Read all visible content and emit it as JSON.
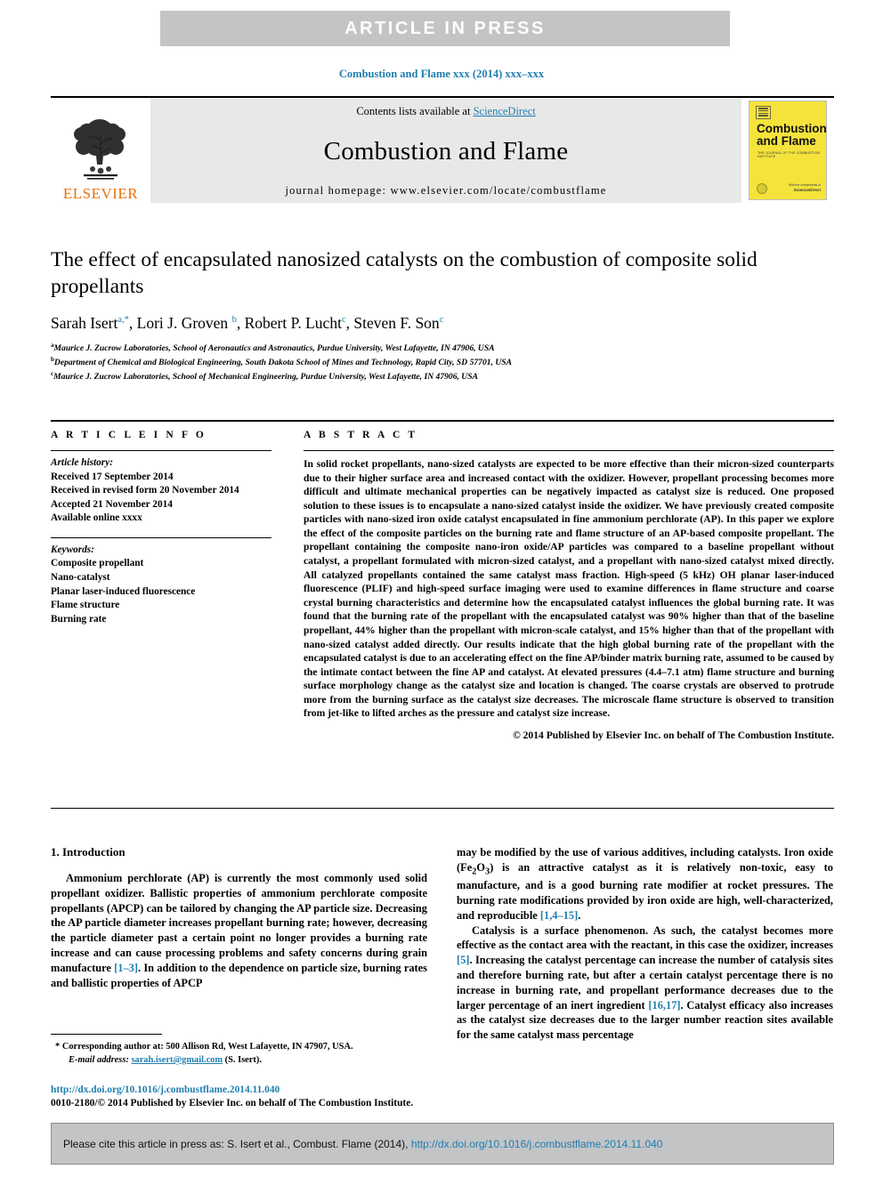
{
  "banner": {
    "text": "ARTICLE  IN  PRESS"
  },
  "journal_ref": "Combustion and Flame xxx (2014) xxx–xxx",
  "masthead": {
    "publisher": "ELSEVIER",
    "contents_prefix": "Contents lists available at ",
    "contents_link": "ScienceDirect",
    "journal_title": "Combustion and Flame",
    "homepage": "journal homepage: www.elsevier.com/locate/combustflame",
    "cover": {
      "line1": "Combustion",
      "line2": "and Flame",
      "subtitle": "THE JOURNAL OF THE COMBUSTION INSTITUTE",
      "footer_small": "With the compliments of",
      "footer_bold": "ScienceDirect"
    }
  },
  "article": {
    "title": "The effect of encapsulated nanosized catalysts on the combustion of composite solid propellants",
    "authors": [
      {
        "name": "Sarah Isert",
        "sup": "a,*"
      },
      {
        "name": "Lori J. Groven",
        "sup": "b"
      },
      {
        "name": "Robert P. Lucht",
        "sup": "c"
      },
      {
        "name": "Steven F. Son",
        "sup": "c"
      }
    ],
    "affiliations": [
      {
        "mark": "a",
        "text": "Maurice J. Zucrow Laboratories, School of Aeronautics and Astronautics, Purdue University, West Lafayette, IN 47906, USA"
      },
      {
        "mark": "b",
        "text": "Department of Chemical and Biological Engineering, South Dakota School of Mines and Technology, Rapid City, SD 57701, USA"
      },
      {
        "mark": "c",
        "text": "Maurice J. Zucrow Laboratories, School of Mechanical Engineering, Purdue University, West Lafayette, IN 47906, USA"
      }
    ]
  },
  "article_info": {
    "heading": "A R T I C L E    I N F O",
    "history_label": "Article history:",
    "history": [
      "Received 17 September 2014",
      "Received in revised form 20 November 2014",
      "Accepted 21 November 2014",
      "Available online xxxx"
    ],
    "keywords_label": "Keywords:",
    "keywords": [
      "Composite propellant",
      "Nano-catalyst",
      "Planar laser-induced fluorescence",
      "Flame structure",
      "Burning rate"
    ]
  },
  "abstract": {
    "heading": "A B S T R A C T",
    "body": "In solid rocket propellants, nano-sized catalysts are expected to be more effective than their micron-sized counterparts due to their higher surface area and increased contact with the oxidizer. However, propellant processing becomes more difficult and ultimate mechanical properties can be negatively impacted as catalyst size is reduced. One proposed solution to these issues is to encapsulate a nano-sized catalyst inside the oxidizer. We have previously created composite particles with nano-sized iron oxide catalyst encapsulated in fine ammonium perchlorate (AP). In this paper we explore the effect of the composite particles on the burning rate and flame structure of an AP-based composite propellant. The propellant containing the composite nano-iron oxide/AP particles was compared to a baseline propellant without catalyst, a propellant formulated with micron-sized catalyst, and a propellant with nano-sized catalyst mixed directly. All catalyzed propellants contained the same catalyst mass fraction. High-speed (5 kHz) OH planar laser-induced fluorescence (PLIF) and high-speed surface imaging were used to examine differences in flame structure and coarse crystal burning characteristics and determine how the encapsulated catalyst influences the global burning rate. It was found that the burning rate of the propellant with the encapsulated catalyst was 90% higher than that of the baseline propellant, 44% higher than the propellant with micron-scale catalyst, and 15% higher than that of the propellant with nano-sized catalyst added directly. Our results indicate that the high global burning rate of the propellant with the encapsulated catalyst is due to an accelerating effect on the fine AP/binder matrix burning rate, assumed to be caused by the intimate contact between the fine AP and catalyst. At elevated pressures (4.4–7.1 atm) flame structure and burning surface morphology change as the catalyst size and location is changed. The coarse crystals are observed to protrude more from the burning surface as the catalyst size decreases. The microscale flame structure is observed to transition from jet-like to lifted arches as the pressure and catalyst size increase.",
    "copyright": "© 2014 Published by Elsevier Inc. on behalf of The Combustion Institute."
  },
  "introduction": {
    "section_title": "1. Introduction",
    "left_para_1_a": "Ammonium perchlorate (AP) is currently the most commonly used solid propellant oxidizer. Ballistic properties of ammonium perchlorate composite propellants (APCP) can be tailored by changing the AP particle size. Decreasing the AP particle diameter increases propellant burning rate; however, decreasing the particle diameter past a certain point no longer provides a burning rate increase and can cause processing problems and safety concerns during grain manufacture ",
    "left_ref_1": "[1–3]",
    "left_para_1_b": ". In addition to the dependence on particle size, burning rates and ballistic properties of APCP",
    "right_para_1_a": "may be modified by the use of various additives, including catalysts. Iron oxide (Fe",
    "right_formula_sub1": "2",
    "right_para_1_b": "O",
    "right_formula_sub2": "3",
    "right_para_1_c": ") is an attractive catalyst as it is relatively non-toxic, easy to manufacture, and is a good burning rate modifier at rocket pressures. The burning rate modifications provided by iron oxide are high, well-characterized, and reproducible ",
    "right_ref_1": "[1,4–15]",
    "right_para_1_d": ".",
    "right_para_2_a": "Catalysis is a surface phenomenon. As such, the catalyst becomes more effective as the contact area with the reactant, in this case the oxidizer, increases ",
    "right_ref_2": "[5]",
    "right_para_2_b": ". Increasing the catalyst percentage can increase the number of catalysis sites and therefore burning rate, but after a certain catalyst percentage there is no increase in burning rate, and propellant performance decreases due to the larger percentage of an inert ingredient ",
    "right_ref_3": "[16,17]",
    "right_para_2_c": ". Catalyst efficacy also increases as the catalyst size decreases due to the larger number reaction sites available for the same catalyst mass percentage"
  },
  "footnote": {
    "corresponding_mark": "*",
    "corresponding_text": "Corresponding author at: 500 Allison Rd, West Lafayette, IN 47907, USA.",
    "email_label": "E-mail address:",
    "email": "sarah.isert@gmail.com",
    "email_suffix": "(S. Isert)."
  },
  "doi": "http://dx.doi.org/10.1016/j.combustflame.2014.11.040",
  "issn_line": "0010-2180/© 2014 Published by Elsevier Inc. on behalf of The Combustion Institute.",
  "cite_box": {
    "prefix": "Please cite this article in press as: S. Isert et al., Combust. Flame (2014), ",
    "link": "http://dx.doi.org/10.1016/j.combustflame.2014.11.040"
  },
  "colors": {
    "link": "#1f7eb0",
    "banner_bg": "#c3c4c6",
    "masthead_bg": "#e8e8e8",
    "elsevier_orange": "#e8700a",
    "cover_yellow": "#f5e33c"
  }
}
